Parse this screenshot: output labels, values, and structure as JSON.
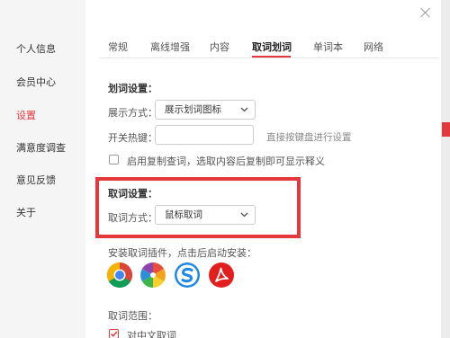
{
  "sidebar": {
    "items": [
      {
        "label": "个人信息",
        "active": false
      },
      {
        "label": "会员中心",
        "active": false
      },
      {
        "label": "设置",
        "active": true
      },
      {
        "label": "满意度调查",
        "active": false
      },
      {
        "label": "意见反馈",
        "active": false
      },
      {
        "label": "关于",
        "active": false
      }
    ]
  },
  "tabs": [
    {
      "label": "常规",
      "active": false
    },
    {
      "label": "离线增强",
      "active": false
    },
    {
      "label": "内容",
      "active": false
    },
    {
      "label": "取词划词",
      "active": true
    },
    {
      "label": "单词本",
      "active": false
    },
    {
      "label": "网络",
      "active": false
    }
  ],
  "huaci": {
    "title": "划词设置：",
    "display_label": "展示方式：",
    "display_value": "展示划词图标",
    "hotkey_label": "开关热键：",
    "hotkey_value": "",
    "hotkey_hint": "直接按键盘进行设置",
    "copy_lookup_label": "启用复制查词，选取内容后复制即可显示释义",
    "copy_lookup_checked": false
  },
  "quci": {
    "title": "取词设置：",
    "mode_label": "取词方式：",
    "mode_value": "鼠标取词"
  },
  "plugins": {
    "title": "安装取词插件，点击后启动安装：",
    "items": [
      "chrome-icon",
      "pinwheel-browser-icon",
      "sogou-browser-icon",
      "acrobat-reader-icon"
    ]
  },
  "range": {
    "title": "取词范围：",
    "first_option": "对中文取词",
    "first_checked": true
  },
  "colors": {
    "accent": "#e4393c",
    "sidebar_bg": "#f5f5f5"
  }
}
